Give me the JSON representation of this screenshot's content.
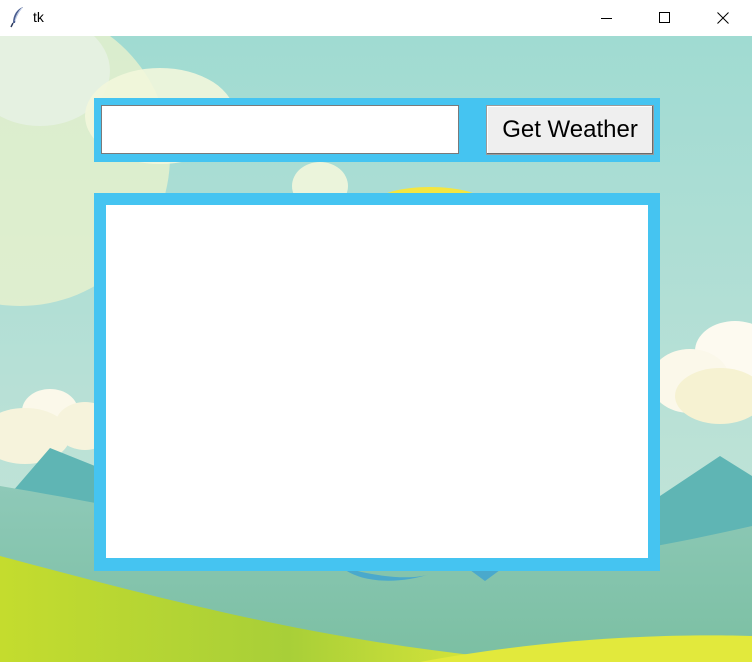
{
  "window": {
    "title": "tk",
    "icon": "tk-feather-icon",
    "controls": [
      "minimize-icon",
      "maximize-icon",
      "close-icon"
    ]
  },
  "form": {
    "city_value": "",
    "button_label": "Get Weather"
  },
  "result": {
    "text": ""
  },
  "colors": {
    "frame": "#45c4f1",
    "sky_top": "#9fdad4",
    "grass": "#b8d832"
  }
}
